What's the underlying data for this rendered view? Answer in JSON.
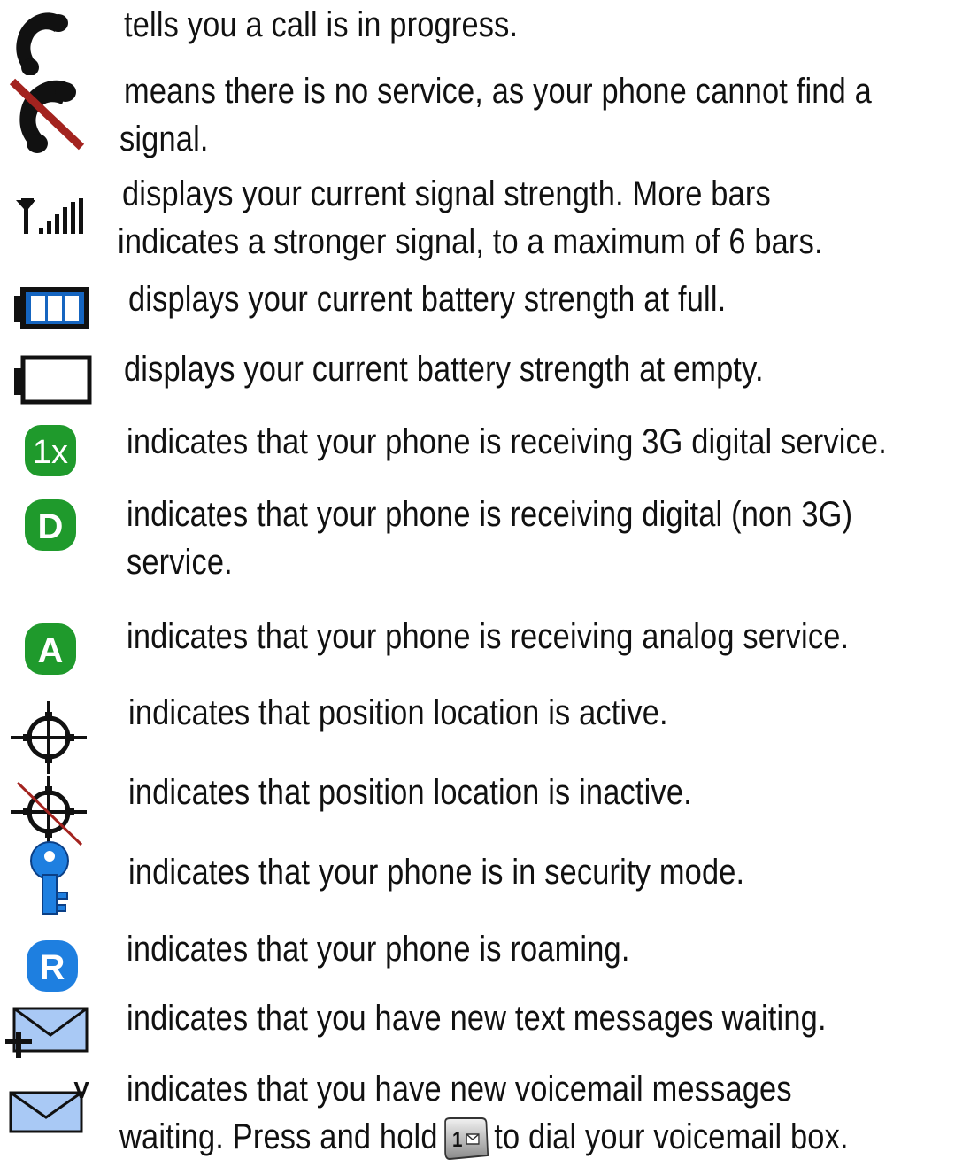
{
  "legend": {
    "call_in_progress": "tells you a call is in progress.",
    "no_service_1": "means there is no service, as your phone cannot find a",
    "no_service_2": "signal.",
    "signal_1": "displays your current signal strength. More bars",
    "signal_2": "indicates a stronger signal, to a maximum of 6 bars.",
    "battery_full": "displays your current battery strength at full.",
    "battery_empty": "displays your current battery strength at empty.",
    "service_3g": "indicates that your phone is receiving 3G digital service.",
    "digital_1": "indicates that your phone is receiving digital (non 3G)",
    "digital_2": "service.",
    "analog": "indicates that your phone is receiving analog service.",
    "location_active": "indicates that position location is active.",
    "location_inactive": "indicates that position location is inactive.",
    "security": "indicates that your phone is in security mode.",
    "roaming": "indicates that your phone is roaming.",
    "text_messages": "indicates that you have new text messages waiting.",
    "voicemail_1": "indicates that you have new voicemail messages",
    "voicemail_2a": "waiting. Press and hold",
    "voicemail_2b": "to dial your voicemail box."
  },
  "icon_labels": {
    "one_x": "1x",
    "digital": "D",
    "analog": "A",
    "roaming": "R",
    "key_one": "1",
    "voicemail_v": "V"
  },
  "colors": {
    "service_green": "#1f9a2c",
    "roam_blue": "#1e7fe0",
    "battery_blue": "#1565c0",
    "envelope_blue": "#a9c9f5",
    "no_service_red": "#a3231f"
  }
}
